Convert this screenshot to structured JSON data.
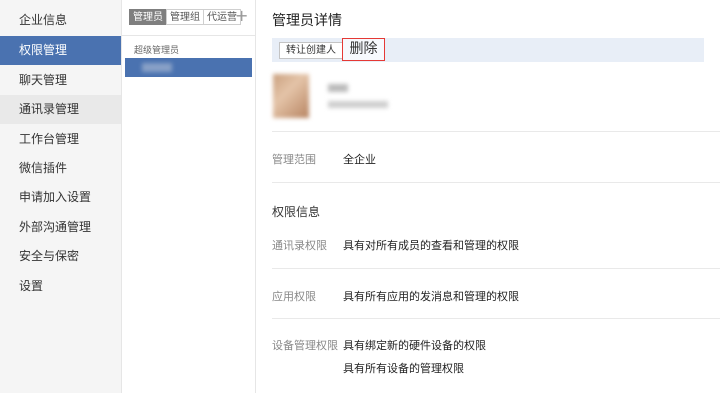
{
  "sidebar": {
    "items": [
      {
        "label": "企业信息"
      },
      {
        "label": "权限管理"
      },
      {
        "label": "聊天管理"
      },
      {
        "label": "通讯录管理"
      },
      {
        "label": "工作台管理"
      },
      {
        "label": "微信插件"
      },
      {
        "label": "申请加入设置"
      },
      {
        "label": "外部沟通管理"
      },
      {
        "label": "安全与保密"
      },
      {
        "label": "设置"
      }
    ],
    "active_index": 1
  },
  "middle": {
    "tabs": [
      "管理员",
      "管理组",
      "代运营"
    ],
    "add_icon": "+",
    "group_label": "超级管理员"
  },
  "detail": {
    "title": "管理员详情",
    "toolbar": {
      "transfer_label": "转让创建人",
      "delete_label": "删除"
    },
    "scope": {
      "label": "管理范围",
      "value": "全企业"
    },
    "permissions_title": "权限信息",
    "permissions": [
      {
        "label": "通讯录权限",
        "value": "具有对所有成员的查看和管理的权限"
      },
      {
        "label": "应用权限",
        "value": "具有所有应用的发消息和管理的权限"
      },
      {
        "label": "设备管理权限",
        "values": [
          "具有绑定新的硬件设备的权限",
          "具有所有设备的管理权限"
        ]
      }
    ]
  },
  "colors": {
    "accent": "#4a72b0",
    "toolbar_bg": "#e8eef7",
    "highlight_border": "#e53935"
  }
}
